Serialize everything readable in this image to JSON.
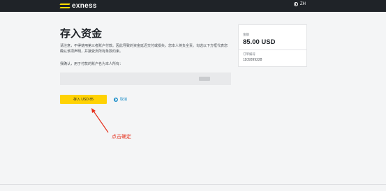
{
  "header": {
    "brand": "exness",
    "language": "ZH",
    "logo_color": "#ffde02",
    "background_color": "#1f2328",
    "language_icon": "globe-icon"
  },
  "main": {
    "title": "存入资金",
    "notice": "请注意，不得使用第三者账户付款。因此导致的资金延迟交付或损失，您本人将负全责。勾选以下方框代表您确认该项声明，并接受页所有条款约束。",
    "confirm_text": "我确认，用于付款的账户名为本人所有：",
    "deposit_button_label": "存入 USD 85",
    "cancel_label": "取消",
    "deposit_button_color": "#ffd204",
    "cancel_icon": "close-circle-icon"
  },
  "annotation": {
    "text": "点击确定",
    "color": "#e5311d"
  },
  "summary": {
    "amount_label": "金额",
    "amount_value": "85.00 USD",
    "order_label": "订单编号",
    "order_value": "1109399228"
  }
}
